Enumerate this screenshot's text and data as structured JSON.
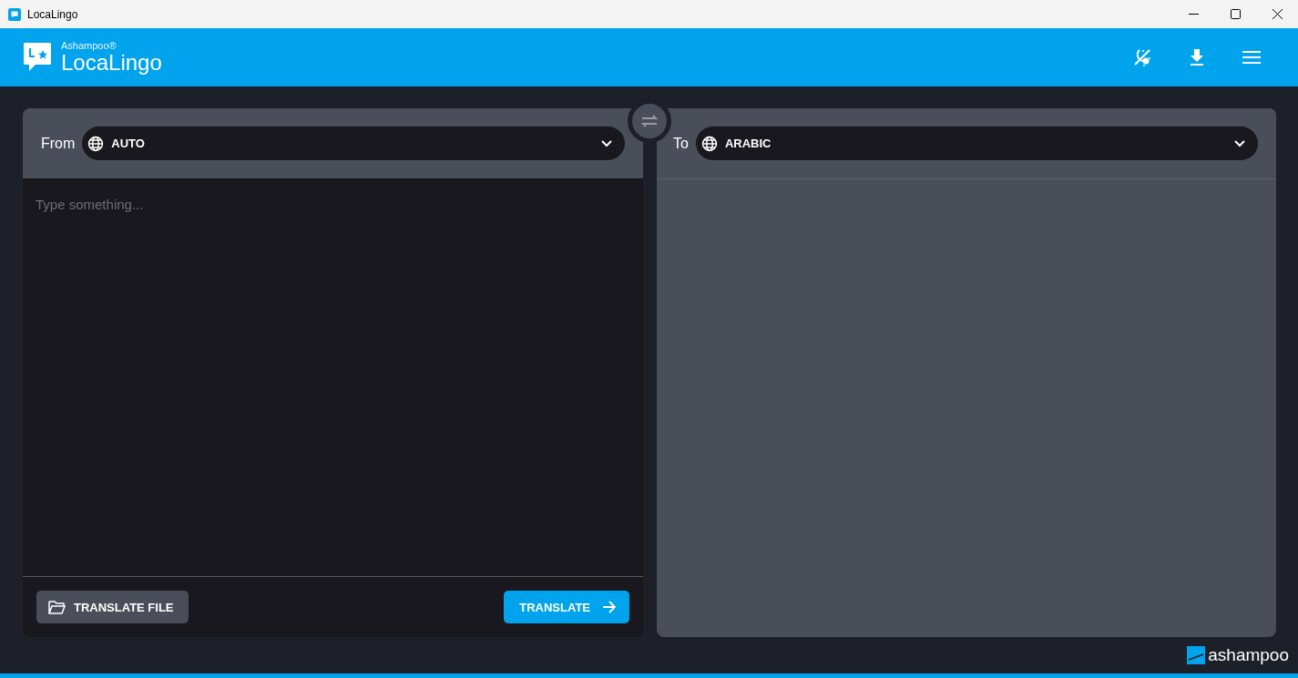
{
  "window": {
    "title": "LocaLingo"
  },
  "header": {
    "brand": "Ashampoo®",
    "product": "LocaLingo"
  },
  "source": {
    "label": "From",
    "language": "AUTO",
    "placeholder": "Type something...",
    "file_button": "TRANSLATE FILE",
    "translate_button": "TRANSLATE"
  },
  "target": {
    "label": "To",
    "language": "ARABIC"
  },
  "footer": {
    "logo": "ashampoo"
  }
}
